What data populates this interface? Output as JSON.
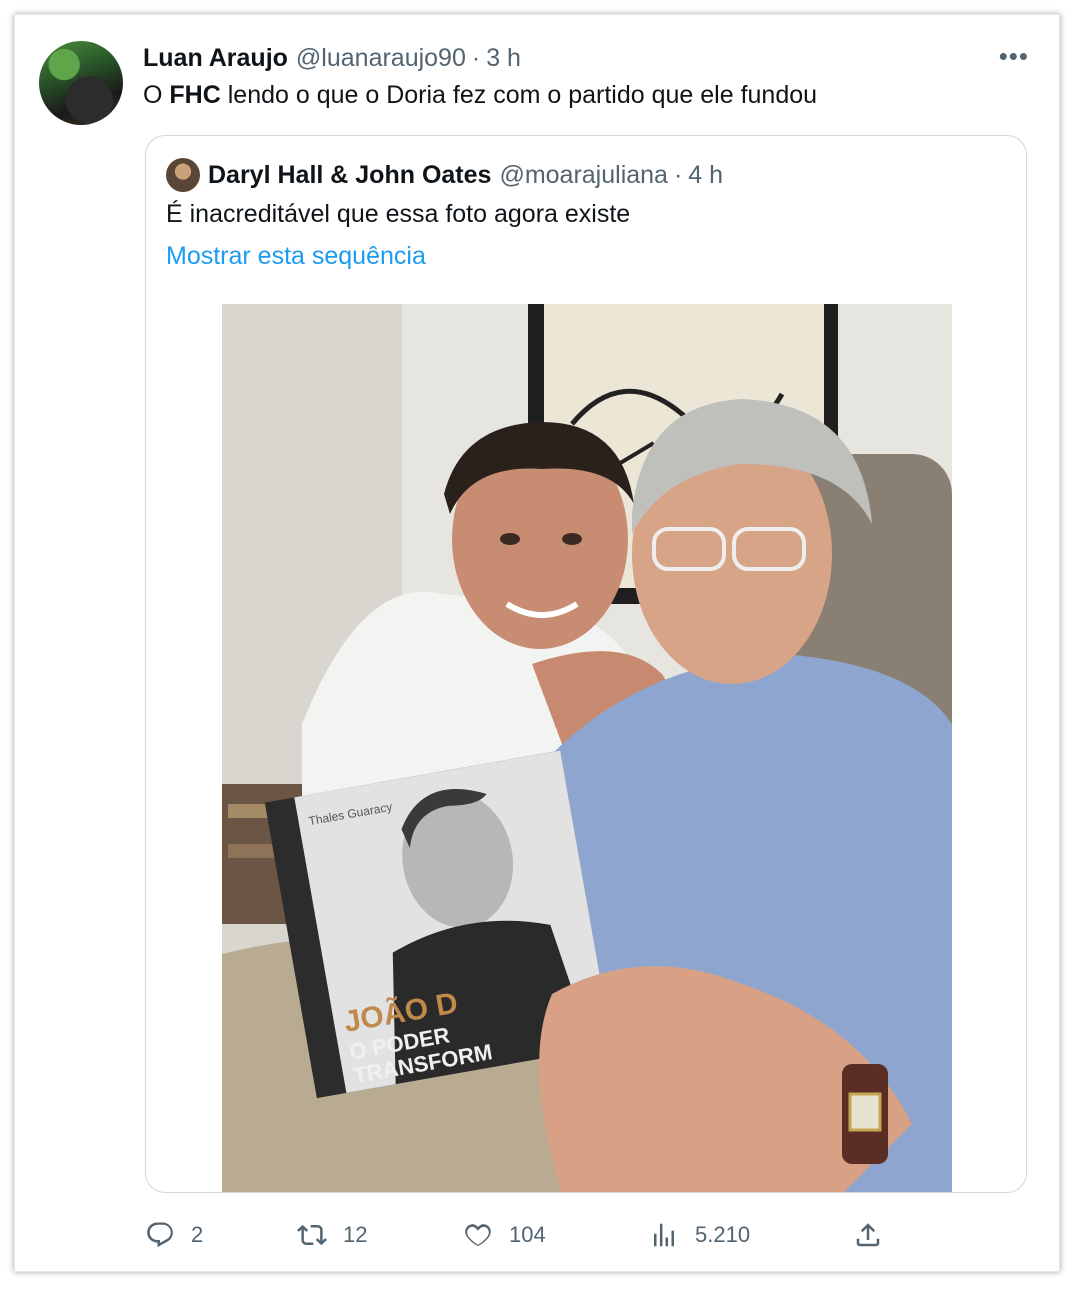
{
  "tweet": {
    "author_name": "Luan Araujo",
    "author_handle": "@luanaraujo90",
    "separator": "·",
    "time": "3 h",
    "more_icon": "more-options-icon",
    "text_prefix": "O ",
    "text_bold": "FHC",
    "text_suffix": " lendo o que o Doria fez com o partido que ele fundou"
  },
  "quoted": {
    "author_name": "Daryl Hall & John Oates",
    "author_handle": "@moarajuliana",
    "separator": "·",
    "time": "4 h",
    "text": "É inacreditável que essa foto agora existe",
    "link": "Mostrar esta sequência",
    "photo": {
      "book_author": "Thales Guaracy",
      "book_title_line1": "JOÃO D",
      "book_title_line2": "O PODER",
      "book_title_line3": "TRANSFORM"
    }
  },
  "actions": {
    "replies": "2",
    "retweets": "12",
    "likes": "104",
    "views": "5.210"
  },
  "colors": {
    "link": "#1d9bf0",
    "secondary_text": "#536471",
    "primary_text": "#0f1419"
  }
}
